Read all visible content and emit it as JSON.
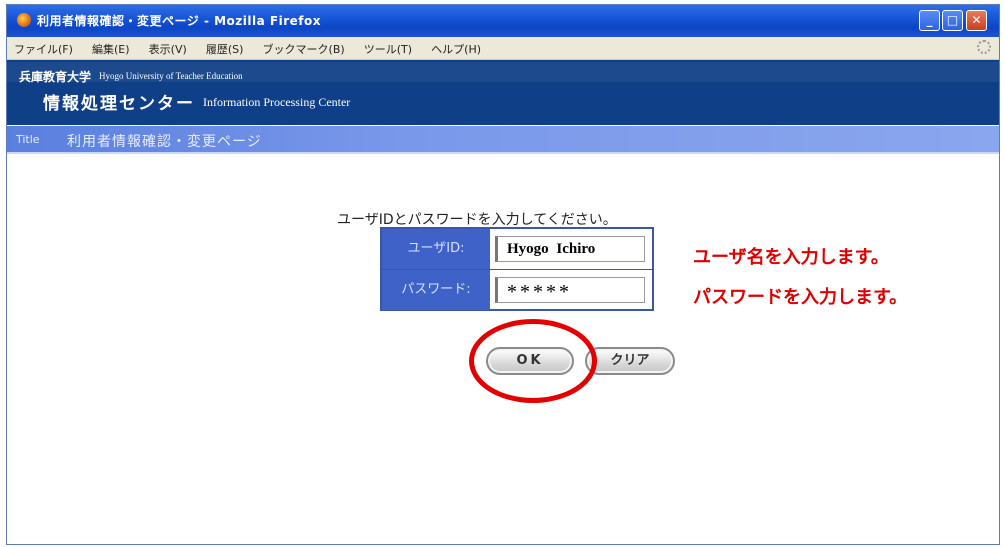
{
  "window": {
    "title": "利用者情報確認・変更ページ - Mozilla Firefox",
    "controls": {
      "minimize": "_",
      "maximize": "□",
      "close": "✕"
    }
  },
  "menubar": {
    "items": [
      "ファイル(F)",
      "編集(E)",
      "表示(V)",
      "履歴(S)",
      "ブックマーク(B)",
      "ツール(T)",
      "ヘルプ(H)"
    ]
  },
  "header": {
    "university_ja": "兵庫教育大学",
    "university_en": "Hyogo University of Teacher Education",
    "center_ja": "情報処理センター",
    "center_en": "Information Processing Center"
  },
  "title_strip": {
    "label": "Title",
    "text": "利用者情報確認・変更ページ"
  },
  "login": {
    "prompt": "ユーザIDとパスワードを入力してください。",
    "user_label": "ユーザID:",
    "user_value": "Hyogo  Ichiro",
    "password_label": "パスワード:",
    "password_value": "*****"
  },
  "buttons": {
    "ok": "OK",
    "clear": "クリア"
  },
  "annotations": {
    "user_note": "ユーザ名を入力します。",
    "password_note": "パスワードを入力します。",
    "highlight_color": "#e40000"
  }
}
